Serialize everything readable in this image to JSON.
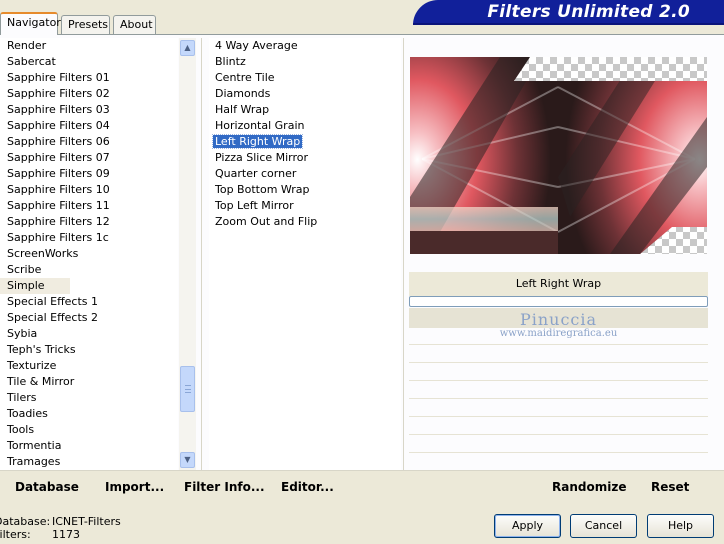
{
  "banner": {
    "title": "Filters Unlimited 2.0"
  },
  "tabs": [
    {
      "label": "Navigator"
    },
    {
      "label": "Presets"
    },
    {
      "label": "About"
    }
  ],
  "categories": [
    "Render",
    "Sabercat",
    "Sapphire Filters 01",
    "Sapphire Filters 02",
    "Sapphire Filters 03",
    "Sapphire Filters 04",
    "Sapphire Filters 06",
    "Sapphire Filters 07",
    "Sapphire Filters 09",
    "Sapphire Filters 10",
    "Sapphire Filters 11",
    "Sapphire Filters 12",
    "Sapphire Filters 1c",
    "ScreenWorks",
    "Scribe",
    "Simple",
    "Special Effects 1",
    "Special Effects 2",
    "Sybia",
    "Teph's Tricks",
    "Texturize",
    "Tile & Mirror",
    "Tilers",
    "Toadies",
    "Tools",
    "Tormentia",
    "Tramages"
  ],
  "selected_category": "Simple",
  "filters": [
    "4 Way Average",
    "Blintz",
    "Centre Tile",
    "Diamonds",
    "Half Wrap",
    "Horizontal Grain",
    "Left Right Wrap",
    "Pizza Slice Mirror",
    "Quarter corner",
    "Top Bottom Wrap",
    "Top Left Mirror",
    "Zoom Out and Flip"
  ],
  "selected_filter": "Left Right Wrap",
  "preview": {
    "filter_name": "Left Right Wrap"
  },
  "watermark": {
    "name": "Pinuccia",
    "site": "www.maidiregrafica.eu"
  },
  "links": {
    "database": "Database",
    "import": "Import...",
    "filter_info": "Filter Info...",
    "editor": "Editor...",
    "randomize": "Randomize",
    "reset": "Reset"
  },
  "status": {
    "database_label": "Database:",
    "database_value": "ICNET-Filters",
    "filters_label": "Filters:",
    "filters_value": "1173"
  },
  "buttons": {
    "apply": "Apply",
    "cancel": "Cancel",
    "help": "Help"
  },
  "colors": {
    "banner": "#11209a",
    "selection": "#316ac5",
    "accent_tab": "#e68b2c"
  }
}
